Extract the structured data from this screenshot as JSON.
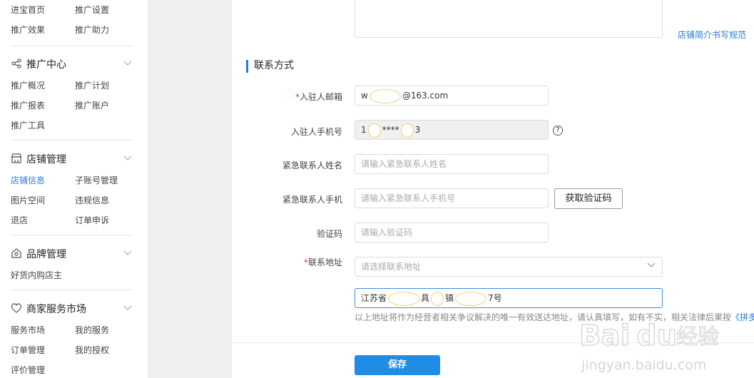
{
  "sidebar": {
    "top_items": [
      "进宝首页",
      "推广设置",
      "推广效果",
      "推广助力"
    ],
    "groups": [
      {
        "title": "推广中心",
        "icon": "share-icon",
        "items": [
          "推广概况",
          "推广计划",
          "推广报表",
          "推广账户",
          "推广工具"
        ]
      },
      {
        "title": "店铺管理",
        "icon": "store-icon",
        "items": [
          "店铺信息",
          "子账号管理",
          "图片空间",
          "违规信息",
          "退店",
          "订单申诉"
        ],
        "active": "店铺信息"
      },
      {
        "title": "品牌管理",
        "icon": "brand-icon",
        "items": [
          "好货内购店主"
        ]
      },
      {
        "title": "商家服务市场",
        "icon": "heart-icon",
        "items": [
          "服务市场",
          "我的服务",
          "订单管理",
          "我的授权",
          "评价管理"
        ]
      }
    ]
  },
  "main": {
    "intro_link": "店铺简介书写规范",
    "section_title": "联系方式",
    "fields": {
      "email": {
        "label": "入驻人邮箱",
        "required": true,
        "value_prefix": "w",
        "value_suffix": "@163.com"
      },
      "phone": {
        "label": "入驻人手机号",
        "value_prefix": "1",
        "value_middle": "****",
        "value_suffix": "3",
        "help": "?"
      },
      "emergency_name": {
        "label": "紧急联系人姓名",
        "placeholder": "请输入紧急联系人姓名"
      },
      "emergency_phone": {
        "label": "紧急联系人手机",
        "placeholder": "请输入紧急联系人手机号",
        "button": "获取验证码"
      },
      "code": {
        "label": "验证码",
        "placeholder": "请输入验证码"
      },
      "address": {
        "label": "联系地址",
        "required": true,
        "placeholder": "请选择联系地址",
        "detail_parts": [
          "江苏省",
          "具",
          "镇",
          "7号"
        ]
      }
    },
    "hint_text": "以上地址将作为经营者相关争议解决的唯一有效送达地址，请认真填写，如有不实，相关法律后果按",
    "hint_link": "《拼多",
    "save_label": "保存"
  },
  "watermark": {
    "brand": "Baidu经验",
    "url": "jingyan.baidu.com"
  },
  "colors": {
    "accent": "#2a7ad2",
    "primary_button": "#1f8de6",
    "required": "#e33333"
  }
}
